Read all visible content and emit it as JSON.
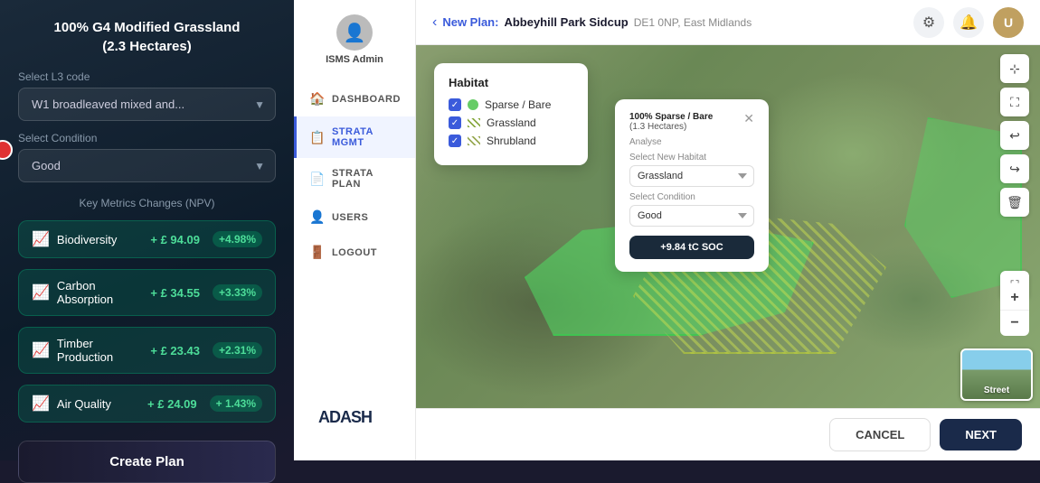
{
  "leftPanel": {
    "title": "100% G4 Modified Grassland\n(2.3 Hectares)",
    "l3Label": "Select L3 code",
    "l3Value": "W1 broadleaved mixed and...",
    "conditionLabel": "Select Condition",
    "conditionValue": "Good",
    "metricsTitle": "Key Metrics Changes (NPV)",
    "metrics": [
      {
        "name": "Biodiversity",
        "value": "+ £ 94.09",
        "pct": "+4.98%"
      },
      {
        "name": "Carbon Absorption",
        "value": "+ £ 34.55",
        "pct": "+3.33%"
      },
      {
        "name": "Timber Production",
        "value": "+ £ 23.43",
        "pct": "+2.31%"
      },
      {
        "name": "Air Quality",
        "value": "+ £ 24.09",
        "pct": "+ 1.43%"
      }
    ],
    "createPlanLabel": "Create Plan"
  },
  "sidebar": {
    "username": "ISMS Admin",
    "items": [
      {
        "id": "dashboard",
        "label": "DASHBOARD",
        "icon": "🏠"
      },
      {
        "id": "strata-mgmt",
        "label": "STRATA  MGMT",
        "icon": "📋",
        "active": true
      },
      {
        "id": "strata-plan",
        "label": "STRATA PLAN",
        "icon": "📄"
      },
      {
        "id": "users",
        "label": "USERS",
        "icon": "👤"
      },
      {
        "id": "logout",
        "label": "LOGOUT",
        "icon": "🚪"
      }
    ],
    "logoText": "ADASH"
  },
  "topBar": {
    "backLabel": "‹",
    "newPlanLabel": "New Plan:",
    "siteNameLabel": "Abbeyhill Park Sidcup",
    "locationLabel": "DE1 0NP, East Midlands",
    "icons": {
      "settings": "⚙",
      "bell": "🔔",
      "user": "U"
    }
  },
  "habitatPopup": {
    "title": "Habitat",
    "items": [
      {
        "label": "Sparse / Bare",
        "colorDot": "#66cc66"
      },
      {
        "label": "Grassland",
        "isHatch": true
      },
      {
        "label": "Shrubland",
        "isHatch2": true
      }
    ]
  },
  "analysePopup": {
    "title": "100% Sparse / Bare",
    "hectares": "(1.3 Hectares)",
    "analyseLabel": "Analyse",
    "selectNewHabitatLabel": "Select New Habitat",
    "selectNewHabitatValue": "Grassland",
    "selectConditionLabel": "Select Condition",
    "selectConditionValue": "Good",
    "socBadge": "+9.84 tC SOC"
  },
  "mapTools": {
    "cursor": "⊕",
    "crop": "⛶",
    "undo": "↩",
    "redo": "↪",
    "trash": "🗑",
    "fullscreen": "⛶",
    "zoomIn": "+",
    "zoomOut": "−"
  },
  "streetView": {
    "label": "Street"
  },
  "bottomBar": {
    "cancelLabel": "CANCEL",
    "nextLabel": "NEXT"
  }
}
